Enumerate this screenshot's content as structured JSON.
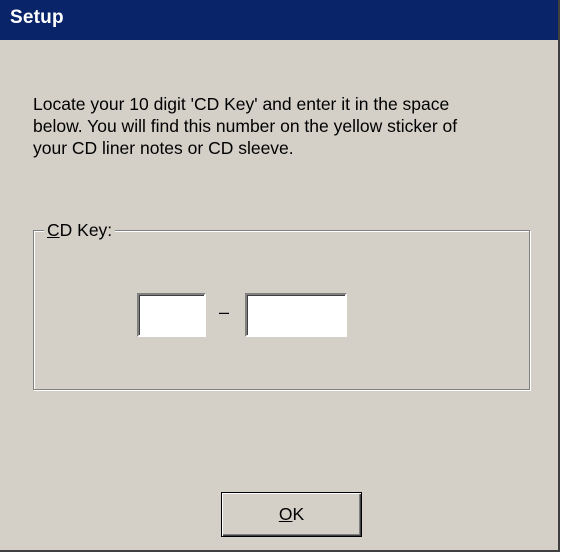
{
  "window": {
    "title": "Setup"
  },
  "instructions": {
    "lines": [
      "Locate your 10 digit 'CD Key' and enter it in the space",
      "below. You will find this number on the yellow sticker of",
      "your CD liner notes or CD sleeve."
    ]
  },
  "cd_key": {
    "label_mnemonic": "C",
    "label_rest": "D Key:",
    "separator": "–",
    "part1_value": "",
    "part2_value": ""
  },
  "buttons": {
    "ok_mnemonic": "O",
    "ok_rest": "K"
  },
  "colors": {
    "title_bar": "#0a246a",
    "dialog_face": "#d4d0c8"
  }
}
